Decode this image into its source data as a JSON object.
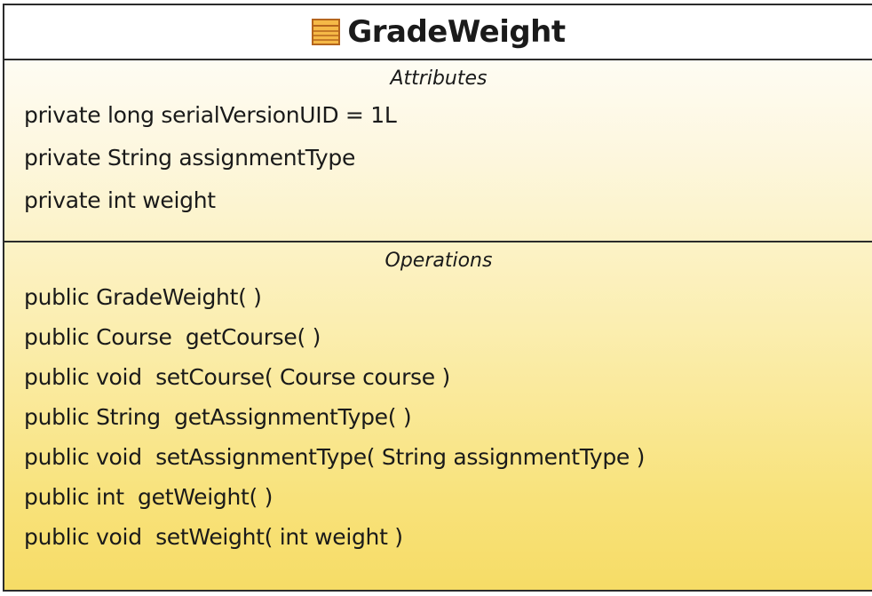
{
  "class": {
    "name": "GradeWeight",
    "icon": "class-icon"
  },
  "attributes": {
    "title": "Attributes",
    "items": [
      "private long serialVersionUID = 1L",
      "private String assignmentType",
      "private int weight"
    ]
  },
  "operations": {
    "title": "Operations",
    "items": [
      "public GradeWeight( )",
      "public Course  getCourse( )",
      "public void  setCourse( Course course )",
      "public String  getAssignmentType( )",
      "public void  setAssignmentType( String assignmentType )",
      "public int  getWeight( )",
      "public void  setWeight( int weight )"
    ]
  },
  "colors": {
    "border": "#2b2b2b",
    "fill_top": "#ffffff",
    "fill_bottom": "#f6dc66",
    "icon_fill": "#f5b947",
    "icon_stroke": "#b5651d"
  }
}
